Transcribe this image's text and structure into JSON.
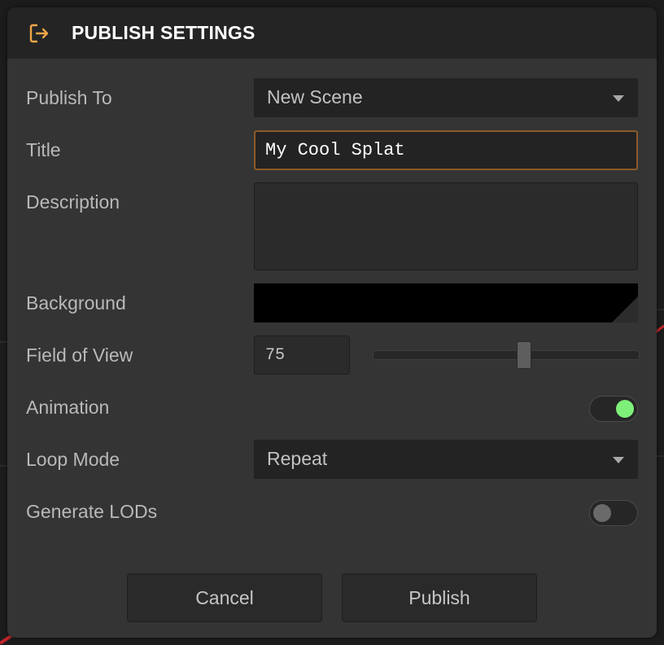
{
  "header": {
    "title": "PUBLISH SETTINGS",
    "icon": "export-icon",
    "icon_color": "#f0a54a"
  },
  "fields": {
    "publish_to": {
      "label": "Publish To",
      "value": "New Scene"
    },
    "title": {
      "label": "Title",
      "value": "My Cool Splat"
    },
    "description": {
      "label": "Description",
      "value": ""
    },
    "background": {
      "label": "Background",
      "color": "#000000"
    },
    "field_of_view": {
      "label": "Field of View",
      "value": "75"
    },
    "animation": {
      "label": "Animation",
      "enabled": true
    },
    "loop_mode": {
      "label": "Loop Mode",
      "value": "Repeat"
    },
    "generate_lods": {
      "label": "Generate LODs",
      "enabled": false
    }
  },
  "buttons": {
    "cancel": "Cancel",
    "publish": "Publish"
  },
  "colors": {
    "toggle_on": "#7ef07a",
    "accent": "#f0a54a"
  }
}
